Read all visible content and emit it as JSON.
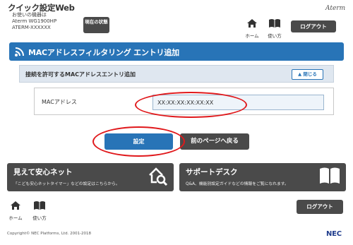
{
  "header": {
    "app_title": "クイック設定Web",
    "device_label": "お使いの機器は",
    "model": "Aterm WG1900HP",
    "ssid": "ATERM-XXXXXX",
    "status_button": "現在の状態",
    "brand_logo": "Aterm",
    "home_label": "ホーム",
    "howto_label": "使い方",
    "logout_label": "ログアウト"
  },
  "page": {
    "title": "MACアドレスフィルタリング エントリ追加"
  },
  "section": {
    "heading": "接続を許可するMACアドレスエントリ追加",
    "close_label": "閉じる",
    "field_label": "MACアドレス",
    "mac_value": "XX:XX:XX:XX:XX:XX"
  },
  "actions": {
    "save_label": "設定",
    "back_label": "前のページへ戻る"
  },
  "banners": [
    {
      "title": "見えて安心ネット",
      "desc": "「こども安心ネットタイマー」などの設定はこちらから。",
      "icon": "house-search-icon"
    },
    {
      "title": "サポートデスク",
      "desc": "Q&A、機能別設定ガイドなどの情報をご覧になれます。",
      "icon": "open-book-icon"
    }
  ],
  "footer": {
    "home_label": "ホーム",
    "howto_label": "使い方",
    "logout_label": "ログアウト",
    "copyright": "Copyright© NEC Platforms, Ltd. 2001-2018",
    "nec_logo": "NEC"
  },
  "colors": {
    "accent_blue": "#2874b7",
    "dark_button": "#4a4a4a",
    "annotation_red": "#e0181b",
    "section_bg": "#dfe7f0"
  }
}
